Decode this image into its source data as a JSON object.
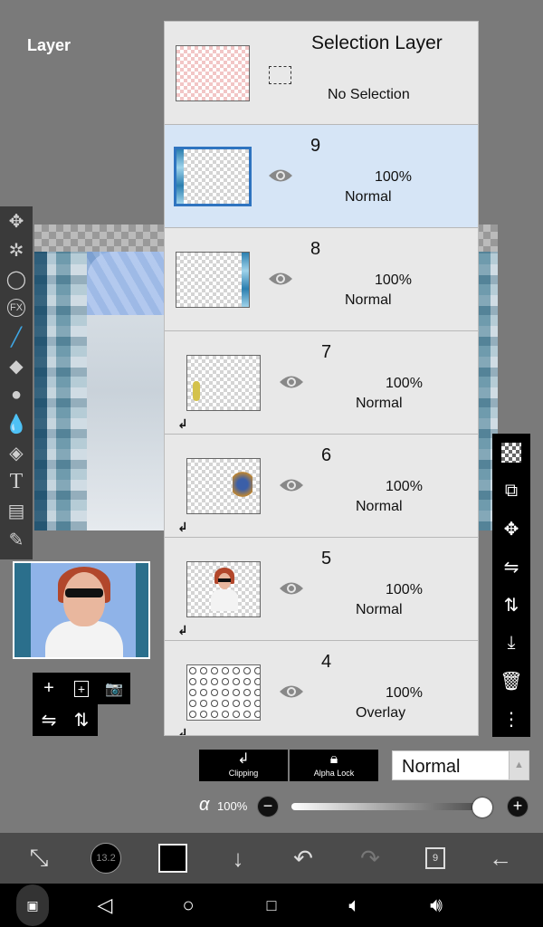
{
  "panel": {
    "title": "Layer"
  },
  "selection_layer": {
    "title": "Selection Layer",
    "status": "No Selection"
  },
  "layers": [
    {
      "num": "9",
      "opacity": "100%",
      "blend": "Normal",
      "selected": true,
      "clipped": false
    },
    {
      "num": "8",
      "opacity": "100%",
      "blend": "Normal",
      "selected": false,
      "clipped": false
    },
    {
      "num": "7",
      "opacity": "100%",
      "blend": "Normal",
      "selected": false,
      "clipped": true
    },
    {
      "num": "6",
      "opacity": "100%",
      "blend": "Normal",
      "selected": false,
      "clipped": true
    },
    {
      "num": "5",
      "opacity": "100%",
      "blend": "Normal",
      "selected": false,
      "clipped": true
    },
    {
      "num": "4",
      "opacity": "100%",
      "blend": "Overlay",
      "selected": false,
      "clipped": true
    }
  ],
  "left_tools": [
    "move-icon",
    "magic-wand-icon",
    "lasso-icon",
    "fx-icon",
    "brush-icon",
    "eraser-icon",
    "smudge-icon",
    "blur-icon",
    "fill-icon",
    "text-icon",
    "frame-divider-icon",
    "eyedropper-icon"
  ],
  "right_tools": [
    "checker-icon",
    "transform-reference-icon",
    "move-cross-icon",
    "flip-horizontal-icon",
    "flip-vertical-icon",
    "merge-down-icon",
    "trash-icon",
    "more-icon"
  ],
  "controls": {
    "clipping_label": "Clipping",
    "alpha_lock_label": "Alpha Lock",
    "blend_mode": "Normal",
    "alpha_symbol": "α",
    "alpha_value": "100%",
    "alpha_level": 1.0
  },
  "app_bar": {
    "brush_size": "13.2",
    "layer_count": "9",
    "current_color": "#000000"
  },
  "colors": {
    "accent": "#2f74c0",
    "selected_bg": "#d6e5f6",
    "panel_bg": "#e8e8e8"
  }
}
